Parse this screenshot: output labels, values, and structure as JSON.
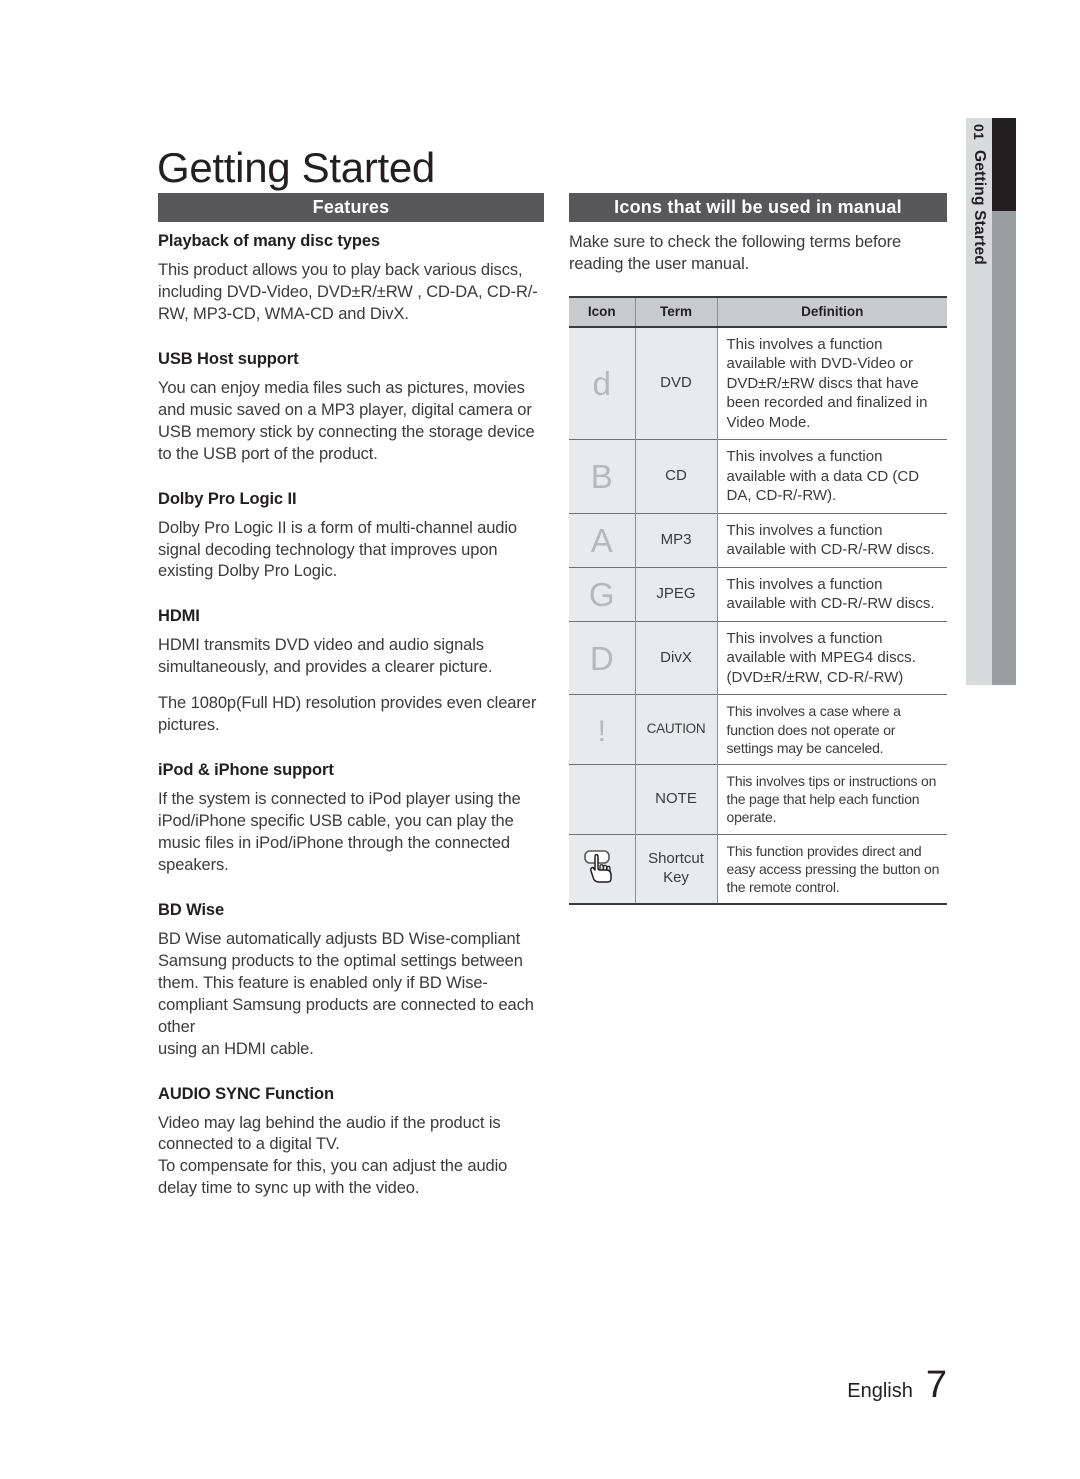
{
  "page": {
    "title": "Getting Started",
    "side_tab_number": "01",
    "side_tab_label": "Getting Started",
    "footer_language": "English",
    "footer_page_number": "7"
  },
  "left_column": {
    "bar_label": "Features",
    "blocks": [
      {
        "heading": "Playback of many disc types",
        "paragraphs": [
          "This product allows you to play back various discs, including DVD-Video, DVD±R/±RW , CD-DA, CD-R/-RW, MP3-CD, WMA-CD and DivX."
        ]
      },
      {
        "heading": "USB Host support",
        "paragraphs": [
          "You can enjoy media files such as pictures, movies and music saved on a MP3 player, digital camera or USB memory stick by connecting the storage device to the USB port of the product."
        ]
      },
      {
        "heading": "Dolby Pro Logic II",
        "paragraphs": [
          "Dolby Pro Logic II is a form of multi-channel audio signal decoding technology that improves upon existing Dolby Pro Logic."
        ]
      },
      {
        "heading": "HDMI",
        "paragraphs": [
          "HDMI transmits DVD video and audio signals simultaneously, and provides a clearer picture.",
          "The 1080p(Full HD) resolution provides even clearer pictures."
        ]
      },
      {
        "heading": "iPod & iPhone support",
        "paragraphs": [
          "If the system is connected to iPod player using the iPod/iPhone specific USB cable, you can play the music files in iPod/iPhone through the connected speakers."
        ]
      },
      {
        "heading": "BD Wise",
        "paragraphs": [
          "BD Wise automatically adjusts BD Wise-compliant Samsung products to the optimal settings between",
          "them. This feature is enabled only if BD Wise-compliant Samsung products are connected to each other",
          "using an HDMI cable."
        ]
      },
      {
        "heading": "AUDIO SYNC Function",
        "paragraphs": [
          "Video may lag behind the audio if the product is connected to a digital TV.",
          "To compensate for this, you can adjust the audio delay time to sync up with the video."
        ]
      }
    ]
  },
  "right_column": {
    "bar_label": "Icons that will be used in manual",
    "intro": "Make sure to check the following terms before reading the user manual.",
    "table": {
      "headers": [
        "Icon",
        "Term",
        "Definition"
      ],
      "rows": [
        {
          "icon_glyph": "d",
          "icon_name": "dvd-icon",
          "term": "DVD",
          "definition": "This involves a function available with DVD-Video or DVD±R/±RW discs that have been recorded and finalized in Video Mode."
        },
        {
          "icon_glyph": "B",
          "icon_name": "cd-icon",
          "term": "CD",
          "definition": "This involves a function available with a data CD (CD DA, CD-R/-RW)."
        },
        {
          "icon_glyph": "A",
          "icon_name": "mp3-icon",
          "term": "MP3",
          "definition": "This involves a function available with CD-R/-RW discs."
        },
        {
          "icon_glyph": "G",
          "icon_name": "jpeg-icon",
          "term": "JPEG",
          "definition": "This involves a function available with CD-R/-RW discs."
        },
        {
          "icon_glyph": "D",
          "icon_name": "divx-icon",
          "term": "DivX",
          "definition": "This involves a function available with MPEG4 discs. (DVD±R/±RW, CD-R/-RW)"
        },
        {
          "icon_glyph": "!",
          "icon_name": "caution-icon",
          "term": "CAUTION",
          "definition": "This involves a case where a function does not operate or settings may be canceled."
        },
        {
          "icon_glyph": "",
          "icon_name": "note-icon",
          "term": "NOTE",
          "definition": "This involves tips or instructions on the page that help each function operate."
        },
        {
          "icon_glyph": "",
          "icon_name": "shortcut-key-icon",
          "term": "Shortcut Key",
          "definition": "This function provides direct and easy access pressing the button on the remote control."
        }
      ]
    }
  },
  "colors": {
    "section_bar": "#58585a",
    "table_header_bg": "#c9cacb",
    "table_cell_bg": "#e9eaeb",
    "side_tab_bg": "#d9dadb",
    "side_bar_dark": "#231f20",
    "side_bar_gray": "#9b9ea1",
    "text": "#231f20"
  }
}
